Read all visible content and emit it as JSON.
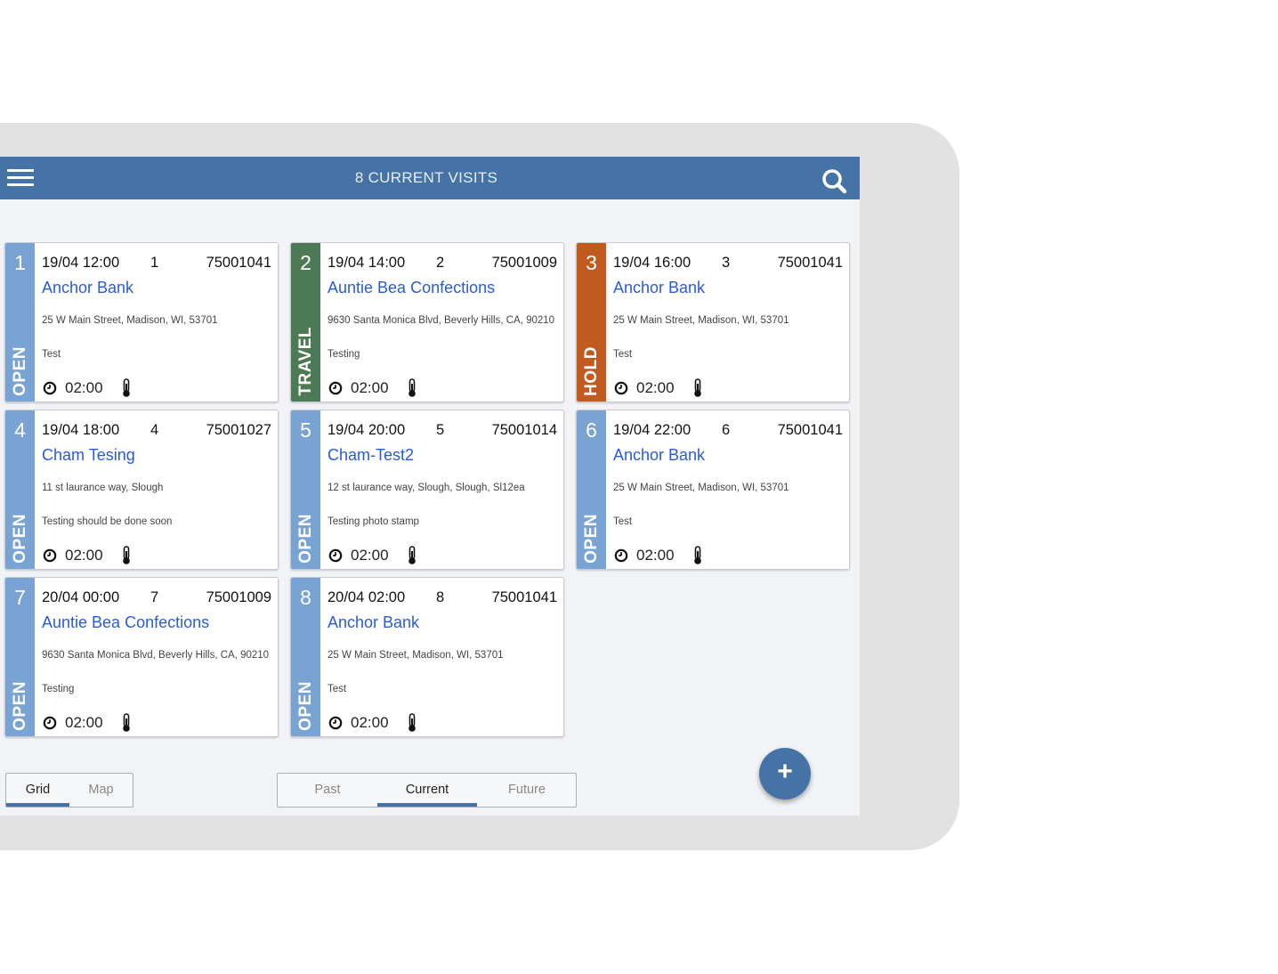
{
  "header": {
    "title": "8 CURRENT VISITS",
    "menu_icon": "hamburger-menu-icon",
    "search_icon": "search-icon",
    "color": "#4673a6"
  },
  "status_colors": {
    "OPEN": "#79a3d3",
    "TRAVEL": "#4b7a55",
    "HOLD": "#c05a1f"
  },
  "visits": [
    {
      "index": "1",
      "status": "OPEN",
      "datetime": "19/04 12:00",
      "seq": "1",
      "ref": "75001041",
      "customer": "Anchor Bank",
      "address": "25 W Main Street, Madison, WI, 53701",
      "notes": "Test",
      "duration": "02:00"
    },
    {
      "index": "2",
      "status": "TRAVEL",
      "datetime": "19/04 14:00",
      "seq": "2",
      "ref": "75001009",
      "customer": "Auntie Bea Confections",
      "address": "9630 Santa Monica Blvd, Beverly Hills, CA, 90210",
      "notes": "Testing",
      "duration": "02:00"
    },
    {
      "index": "3",
      "status": "HOLD",
      "datetime": "19/04 16:00",
      "seq": "3",
      "ref": "75001041",
      "customer": "Anchor Bank",
      "address": "25 W Main Street, Madison, WI, 53701",
      "notes": "Test",
      "duration": "02:00"
    },
    {
      "index": "4",
      "status": "OPEN",
      "datetime": "19/04 18:00",
      "seq": "4",
      "ref": "75001027",
      "customer": "Cham Tesing",
      "address": "11 st laurance way, Slough",
      "notes": "Testing should be done soon",
      "duration": "02:00"
    },
    {
      "index": "5",
      "status": "OPEN",
      "datetime": "19/04 20:00",
      "seq": "5",
      "ref": "75001014",
      "customer": "Cham-Test2",
      "address": "12 st laurance way, Slough, Slough, Sl12ea",
      "notes": "Testing photo stamp",
      "duration": "02:00"
    },
    {
      "index": "6",
      "status": "OPEN",
      "datetime": "19/04 22:00",
      "seq": "6",
      "ref": "75001041",
      "customer": "Anchor Bank",
      "address": "25 W Main Street, Madison, WI, 53701",
      "notes": "Test",
      "duration": "02:00"
    },
    {
      "index": "7",
      "status": "OPEN",
      "datetime": "20/04 00:00",
      "seq": "7",
      "ref": "75001009",
      "customer": "Auntie Bea Confections",
      "address": "9630 Santa Monica Blvd, Beverly Hills, CA, 90210",
      "notes": "Testing",
      "duration": "02:00"
    },
    {
      "index": "8",
      "status": "OPEN",
      "datetime": "20/04 02:00",
      "seq": "8",
      "ref": "75001041",
      "customer": "Anchor Bank",
      "address": "25 W Main Street, Madison, WI, 53701",
      "notes": "Test",
      "duration": "02:00"
    }
  ],
  "view_toggle": {
    "options": [
      "Grid",
      "Map"
    ],
    "selected": "Grid"
  },
  "time_filter": {
    "options": [
      "Past",
      "Current",
      "Future"
    ],
    "selected": "Current"
  },
  "fab": {
    "icon": "plus-icon",
    "label": "+"
  }
}
